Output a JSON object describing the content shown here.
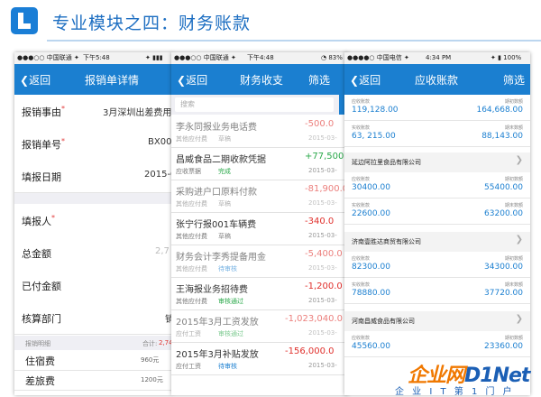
{
  "slide": {
    "title": "专业模块之四：财务账款"
  },
  "phone1": {
    "status": {
      "carrier": "●●●○○ 中国联通 ✦",
      "time": "下午5:48",
      "battery": "✦ ▮▮▮"
    },
    "nav": {
      "back": "返回",
      "title": "报销单详情"
    },
    "fields": [
      {
        "label": "报销事由",
        "required": "*",
        "value": "3月深圳出差费用"
      },
      {
        "label": "报销单号",
        "required": "*",
        "value": "BX00"
      },
      {
        "label": "填报日期",
        "required": "",
        "value": "2015-0"
      },
      {
        "label": "填报人",
        "required": "*",
        "value": ""
      },
      {
        "label": "总金额",
        "required": "",
        "value": "2,7"
      },
      {
        "label": "已付金额",
        "required": "",
        "value": ""
      },
      {
        "label": "核算部门",
        "required": "",
        "value": "销"
      }
    ],
    "detail_header": {
      "label": "报销明细",
      "total_label": "合计:",
      "total_value": "2,74"
    },
    "details": [
      {
        "label": "住宿费",
        "amount": "960元"
      },
      {
        "label": "差旅费",
        "amount": "1200元"
      }
    ]
  },
  "phone2": {
    "status": {
      "carrier": "●●●○○ 中国联通 ✦",
      "time": "下午4:48",
      "battery": "◔ 83%"
    },
    "nav": {
      "back": "返回",
      "title": "财务收支",
      "right": "筛选"
    },
    "search": {
      "placeholder": "搜索"
    },
    "records": [
      {
        "title": "李永同报业务电话费",
        "amount": "-500.0",
        "type": "其他应付费",
        "status": "草稿",
        "date": "2015-03-"
      },
      {
        "title": "昌威食品二期收款凭据",
        "amount": "+77,500.0",
        "type": "应收票据",
        "status": "完成",
        "date": "2015-03-"
      },
      {
        "title": "采购进户口原料付款",
        "amount": "-81,900.0",
        "type": "其他应付费",
        "status": "草稿",
        "date": "2015-03-"
      },
      {
        "title": "张宁行报001车辆费",
        "amount": "-340.0",
        "type": "其他应付费",
        "status": "草稿",
        "date": "2015-03-"
      },
      {
        "title": "财务会计李秀提备用金",
        "amount": "-5,400.0",
        "type": "其他应付费",
        "status": "待审核",
        "date": "2015-03-"
      },
      {
        "title": "王海报业务招待费",
        "amount": "-1,200.0",
        "type": "其他应付费",
        "status": "审核通过",
        "date": "2015-03-"
      },
      {
        "title": "2015年3月工资发放",
        "amount": "-1,023,040.0",
        "type": "应付工资",
        "status": "审核通过",
        "date": "2015-03-"
      },
      {
        "title": "2015年3月补贴发放",
        "amount": "-156,000.0",
        "type": "应付工资",
        "status": "待审核",
        "date": "2015-03-"
      }
    ],
    "colors": {
      "positive": "#2aa84a",
      "negative": "#e0302c",
      "draft": "#888888",
      "done": "#2aa84a",
      "pending": "#1b7fd0",
      "approved": "#2aa84a"
    }
  },
  "phone3": {
    "status": {
      "carrier": "●●●●○ 中国电信 ✦",
      "time": "4:34 PM",
      "battery": "✦ ▮ 100%"
    },
    "nav": {
      "back": "返回",
      "title": "应收账款",
      "right": "筛选"
    },
    "summary": [
      {
        "left_label": "应收账款",
        "left_value": "119,128.00",
        "right_label": "期初数额",
        "right_value": "164,668.00"
      },
      {
        "left_label": "实收账款",
        "left_value": "63, 215.00",
        "right_label": "期末数额",
        "right_value": "88,143.00"
      }
    ],
    "customers": [
      {
        "name": "延边阿拉里食品有限公司",
        "rows": [
          {
            "left_label": "应收账款",
            "left_value": "30400.00",
            "right_label": "期初数额",
            "right_value": "55400.00"
          },
          {
            "left_label": "实收账款",
            "left_value": "22600.00",
            "right_label": "期末数额",
            "right_value": "63200.00"
          }
        ]
      },
      {
        "name": "济南壹胜达商贸有限公司",
        "rows": [
          {
            "left_label": "应收账款",
            "left_value": "82300.00",
            "right_label": "期初数额",
            "right_value": "34300.00"
          },
          {
            "left_label": "实收账款",
            "left_value": "78880.00",
            "right_label": "期末数额",
            "right_value": "37720.00"
          }
        ]
      },
      {
        "name": "河南昌威食品有限公司",
        "rows": [
          {
            "left_label": "应收账款",
            "left_value": "45560.00",
            "right_label": "期初数额",
            "right_value": "23360.00"
          }
        ]
      }
    ]
  },
  "watermark": {
    "part1": "企业网",
    "part2": "D1Net",
    "sub": "企 业 I T 第 1 门 户"
  }
}
